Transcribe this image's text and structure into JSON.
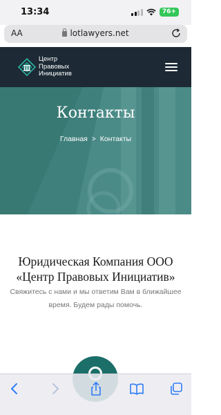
{
  "status_bar": {
    "time": "13:34",
    "battery": "76+"
  },
  "address_bar": {
    "text_size_label": "AA",
    "url": "lotlawyers.net"
  },
  "header": {
    "logo_line1": "Центр",
    "logo_line2": "Правовых",
    "logo_line3": "Инициатив"
  },
  "hero": {
    "title": "Контакты",
    "breadcrumb_home": "Главная",
    "breadcrumb_separator": ">",
    "breadcrumb_current": "Контакты"
  },
  "main": {
    "company_line1": "Юридическая Компания ООО",
    "company_line2": "«Центр Правовых Инициатив»",
    "subtitle": "Свяжитесь с нами  и мы ответим Вам в ближайшее время. Будем рады помочь."
  },
  "colors": {
    "header_bg": "#1d2a35",
    "hero_teal": "#3c7d79",
    "accent": "#1c6e69",
    "ios_blue": "#2f7cf6"
  },
  "icons": {
    "signal": "signal-icon",
    "wifi": "wifi-icon",
    "lock": "lock-icon",
    "reload": "reload-icon",
    "menu": "hamburger-menu-icon",
    "back": "chevron-left-icon",
    "forward": "chevron-right-icon",
    "share": "share-icon",
    "bookmarks": "book-icon",
    "tabs": "tabs-icon"
  }
}
